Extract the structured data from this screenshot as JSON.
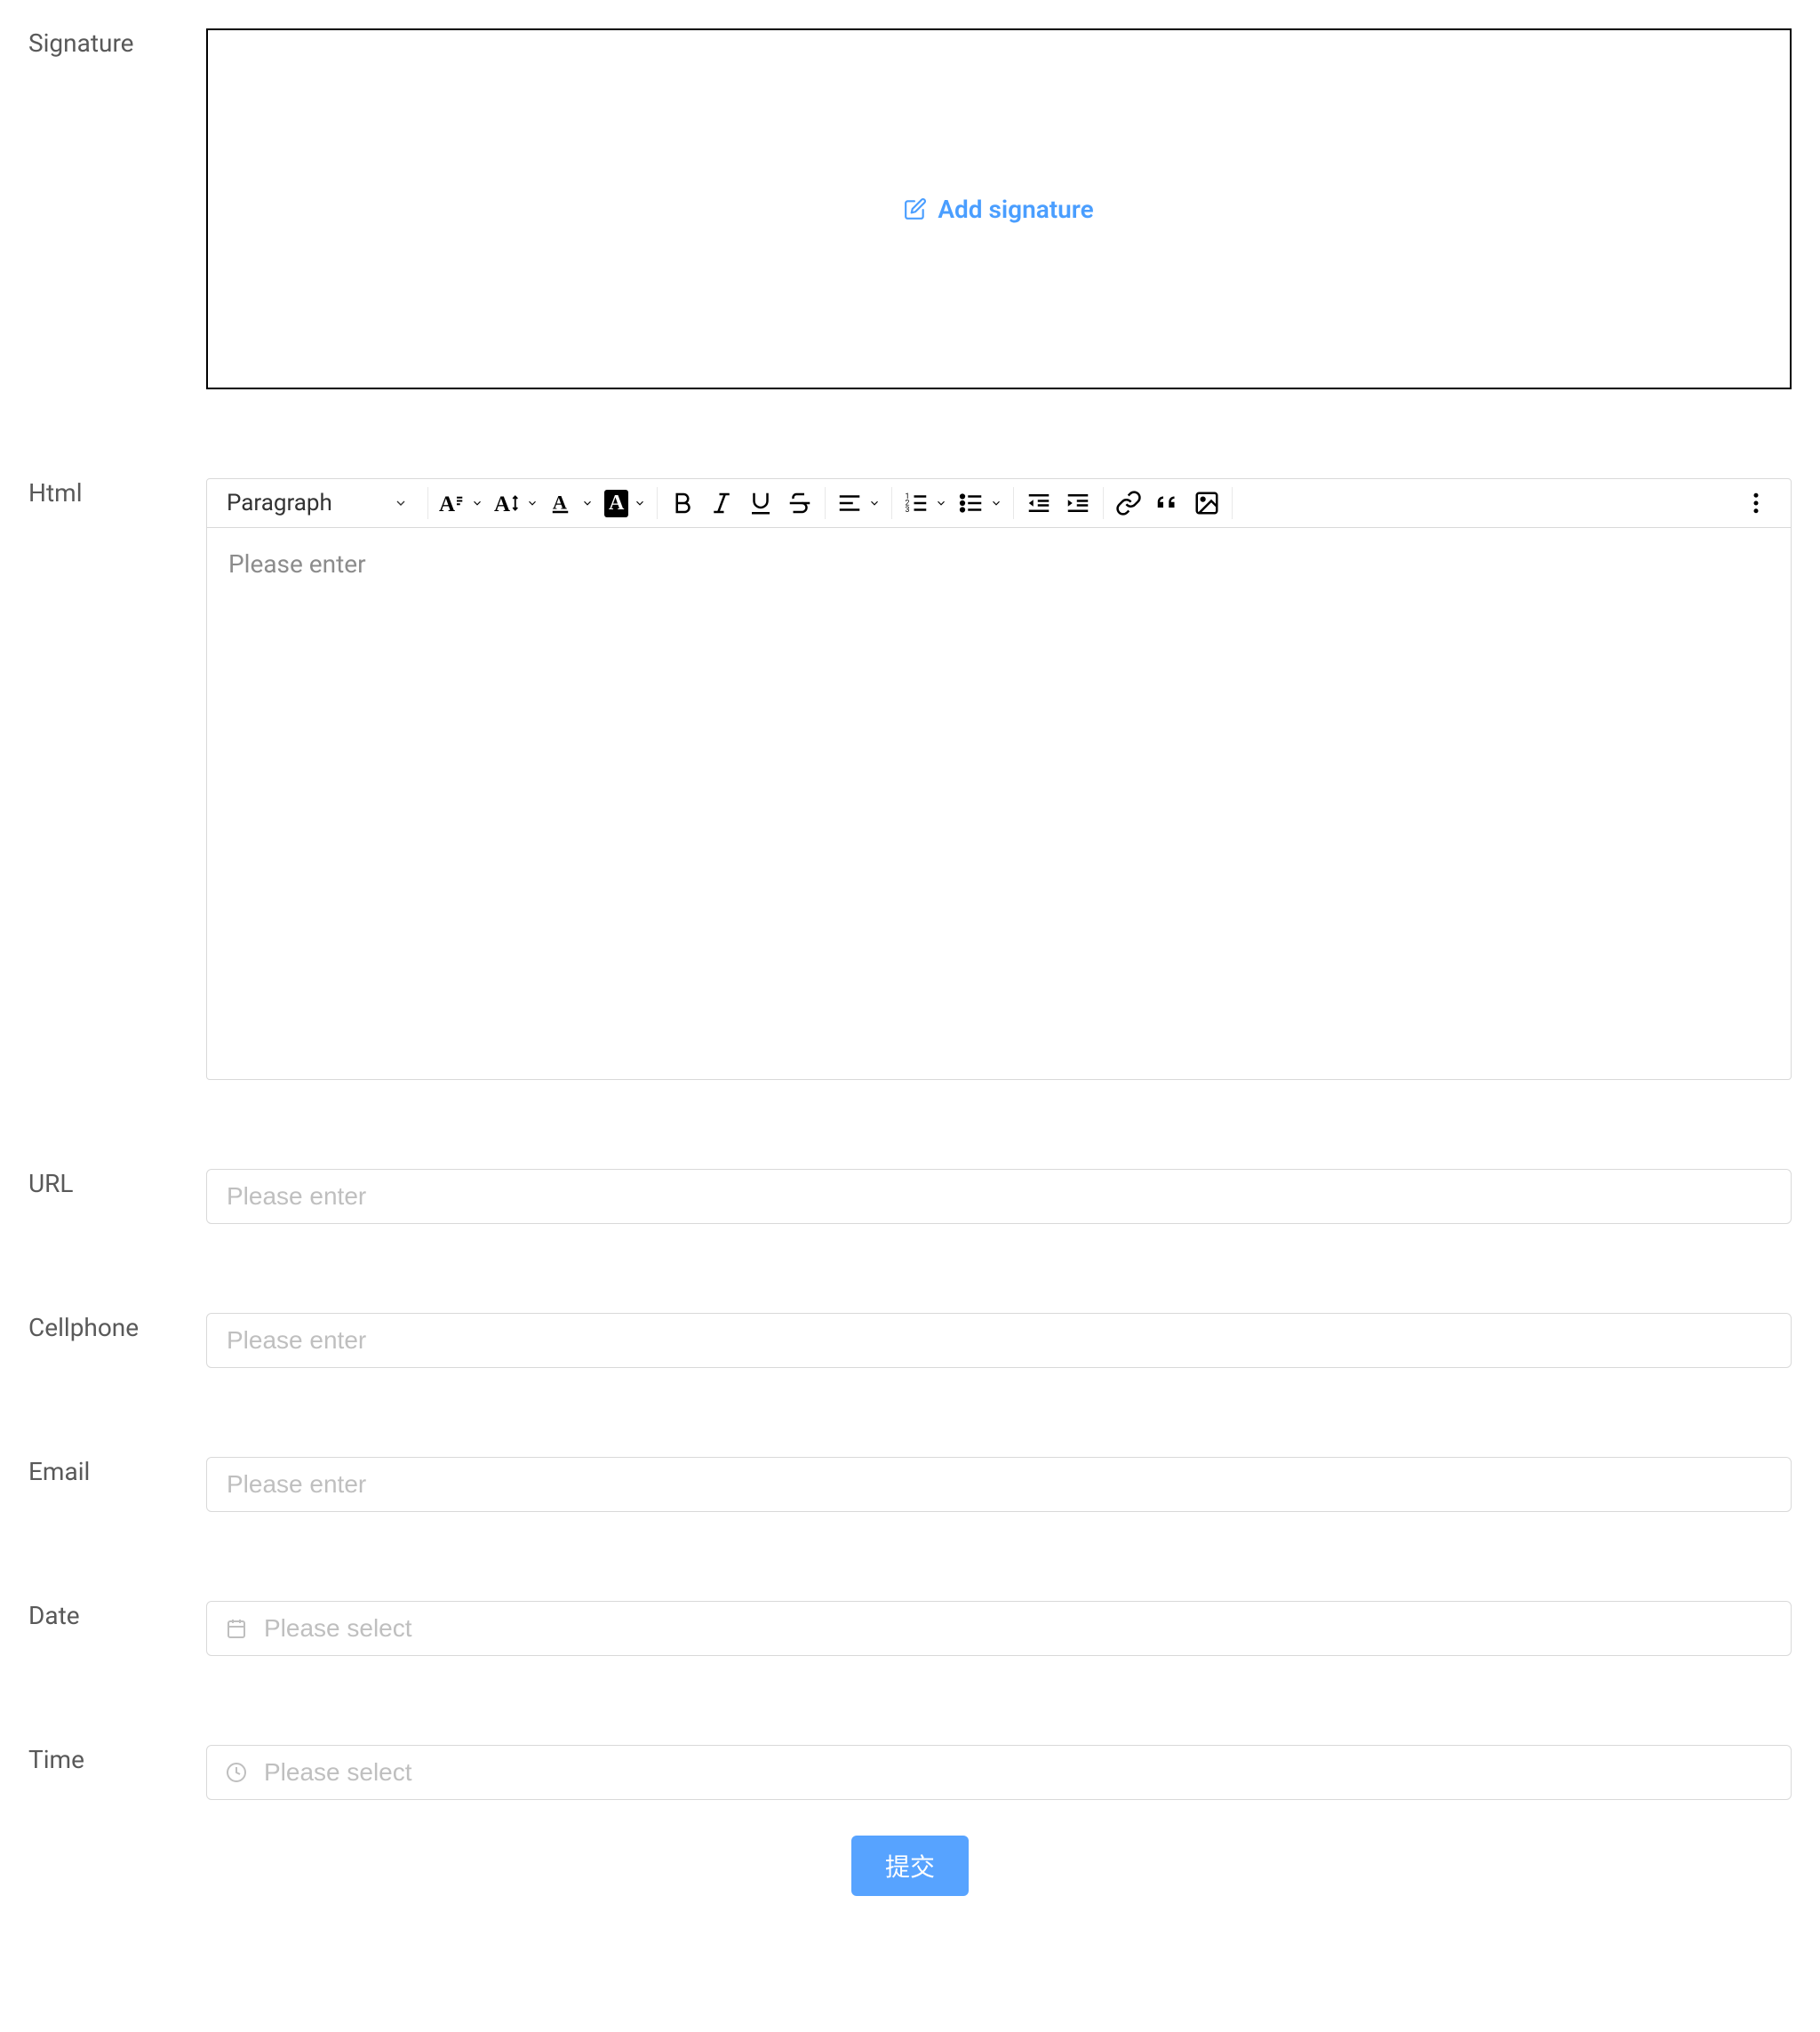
{
  "signature": {
    "label": "Signature",
    "add_label": "Add signature"
  },
  "html": {
    "label": "Html",
    "paragraph_label": "Paragraph",
    "placeholder": "Please enter"
  },
  "url": {
    "label": "URL",
    "placeholder": "Please enter"
  },
  "cellphone": {
    "label": "Cellphone",
    "placeholder": "Please enter"
  },
  "email": {
    "label": "Email",
    "placeholder": "Please enter"
  },
  "date": {
    "label": "Date",
    "placeholder": "Please select"
  },
  "time": {
    "label": "Time",
    "placeholder": "Please select"
  },
  "submit": {
    "label": "提交"
  }
}
